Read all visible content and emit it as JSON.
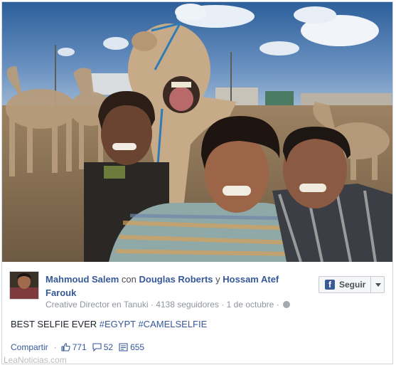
{
  "post": {
    "author": "Mahmoud Salem",
    "with_word": "con",
    "tagged_1": "Douglas Roberts",
    "and_word": "y",
    "tagged_2": "Hossam Atef Farouk",
    "role": "Creative Director en Tanuki",
    "dot_1": "·",
    "followers": "4138 seguidores",
    "dot_2": "·",
    "date": "1 de octubre",
    "dot_3": "·",
    "message_text": "BEST SELFIE EVER",
    "hashtag_1": "#EGYPT",
    "hashtag_2": "#CAMELSELFIE"
  },
  "follow_button": {
    "label": "Seguir",
    "icon": "facebook-icon"
  },
  "actions": {
    "share_label": "Compartir",
    "dot": "·",
    "likes": "771",
    "comments": "52",
    "shares": "655",
    "like_icon": "thumbs-up-icon",
    "comment_icon": "comment-icon",
    "share_icon": "share-icon"
  },
  "watermark": "LeaNoticias.com",
  "colors": {
    "link_blue": "#365899",
    "facebook_blue": "#3b5998",
    "meta_gray": "#90949c"
  }
}
